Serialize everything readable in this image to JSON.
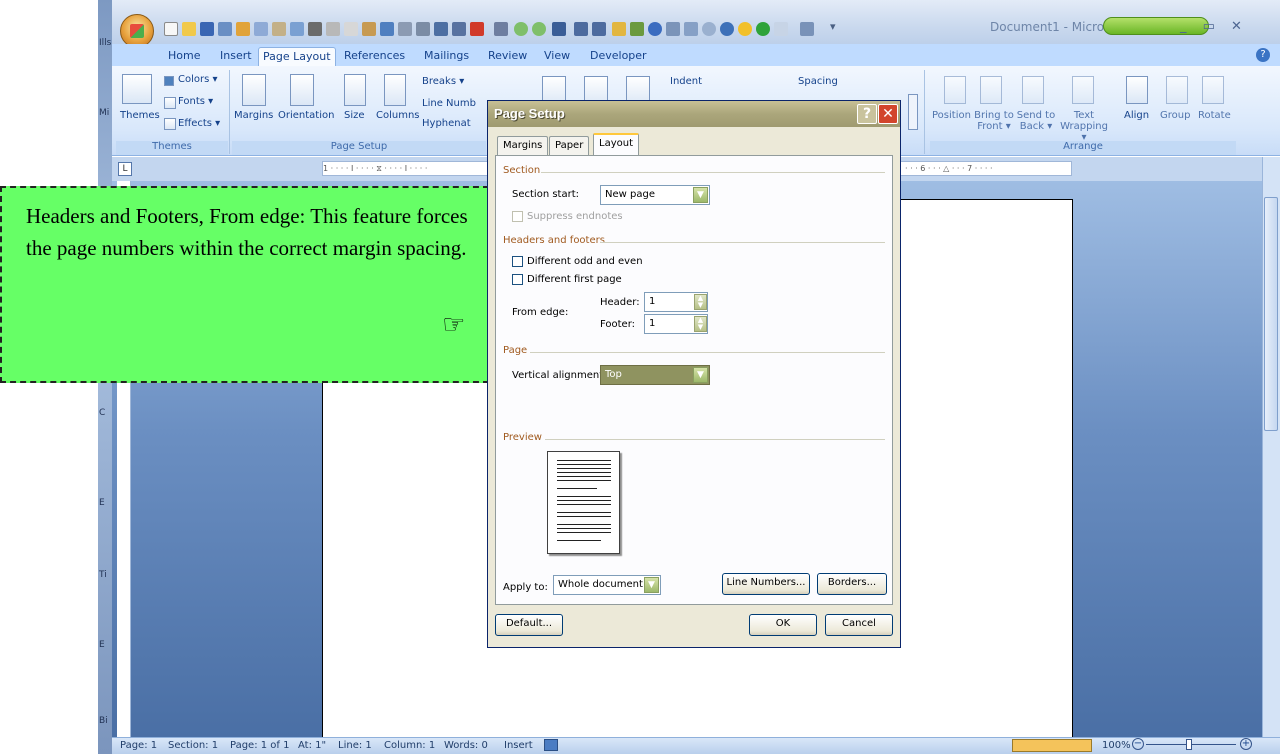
{
  "left_strip_labels": [
    "Ills",
    "Mi",
    "Ml",
    "C",
    "E",
    "E",
    "Ti",
    "E",
    "Bi"
  ],
  "title_bar": {
    "doc_title": "Document1 - Micros",
    "window_controls": "_ ▭ ✕"
  },
  "ribbon_tabs": [
    "Home",
    "Insert",
    "Page Layout",
    "References",
    "Mailings",
    "Review",
    "View",
    "Developer"
  ],
  "active_tab": "Page Layout",
  "ribbon": {
    "themes_group": {
      "label": "Themes",
      "themes_btn": "Themes",
      "colors": "Colors ▾",
      "fonts": "Fonts ▾",
      "effects": "Effects ▾"
    },
    "page_setup_group": {
      "label": "Page Setup",
      "margins": "Margins",
      "orientation": "Orientation",
      "size": "Size",
      "columns": "Columns",
      "breaks": "Breaks ▾",
      "line_numbers": "Line Numb",
      "hyphenation": "Hyphenat"
    },
    "paragraph_group": {
      "indent": "Indent",
      "spacing": "Spacing"
    },
    "arrange_group": {
      "label": "Arrange",
      "position": "Position",
      "bring_to_front": "Bring to Front ▾",
      "send_to_back": "Send to Back ▾",
      "text_wrapping": "Text Wrapping ▾",
      "align": "Align",
      "group": "Group",
      "rotate": "Rotate"
    }
  },
  "ruler": {
    "ticks": "1 · · · · I · · · · ⧖ · · · · I · · · ·",
    "ticks_right": "· · · 6 · · · △ · · · 7 · · · ·"
  },
  "callout": {
    "text": "Headers and Footers, From edge: This feature forces the page numbers within the correct margin spacing.",
    "icon": "pointing-hand-icon"
  },
  "dialog": {
    "title": "Page Setup",
    "tabs": [
      "Margins",
      "Paper",
      "Layout"
    ],
    "active_tab": "Layout",
    "section": {
      "heading": "Section",
      "section_start_label": "Section start:",
      "section_start_value": "New page",
      "suppress_endnotes": "Suppress endnotes"
    },
    "headers_footers": {
      "heading": "Headers and footers",
      "diff_odd_even": "Different odd and even",
      "diff_first_page": "Different first page",
      "from_edge": "From edge:",
      "header_label": "Header:",
      "header_value": "1",
      "footer_label": "Footer:",
      "footer_value": "1"
    },
    "page": {
      "heading": "Page",
      "vertical_alignment_label": "Vertical alignment:",
      "vertical_alignment_value": "Top"
    },
    "preview": {
      "heading": "Preview",
      "apply_to_label": "Apply to:",
      "apply_to_value": "Whole document",
      "line_numbers_btn": "Line Numbers...",
      "borders_btn": "Borders..."
    },
    "buttons": {
      "default": "Default...",
      "ok": "OK",
      "cancel": "Cancel"
    }
  },
  "status_bar": {
    "page": "Page: 1",
    "section": "Section: 1",
    "page_of": "Page: 1 of 1",
    "at": "At: 1\"",
    "line": "Line: 1",
    "column": "Column: 1",
    "words": "Words: 0",
    "mode": "Insert",
    "zoom": "100%"
  },
  "colors": {
    "callout_bg": "#66ff66",
    "ribbon_bg": "#d9e8fb",
    "dialog_bg": "#ece9d8",
    "workspace": "#6b8fc2"
  }
}
